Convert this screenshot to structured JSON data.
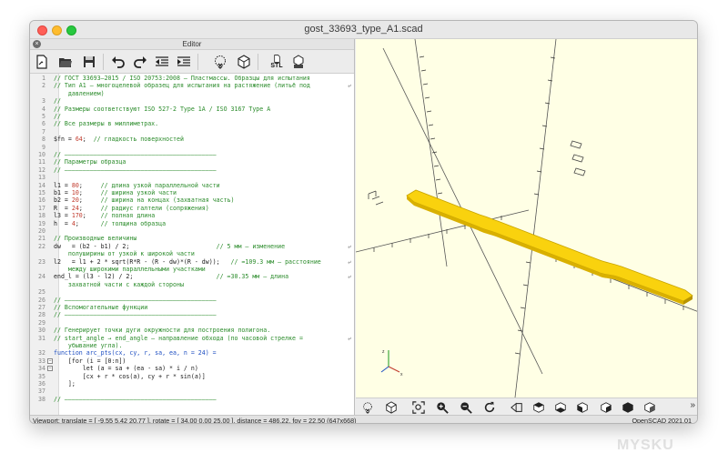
{
  "window": {
    "title": "gost_33693_type_A1.scad"
  },
  "editor": {
    "title": "Editor",
    "close_icon": "close-x",
    "toolbar": [
      "new-file-icon",
      "open-folder-icon",
      "save-icon",
      "undo-icon",
      "redo-icon",
      "unindent-icon",
      "indent-icon",
      "preview-icon",
      "render-icon",
      "export-stl-icon",
      "send-to-print-icon"
    ],
    "stl_label": "STL",
    "lines": [
      {
        "n": "1",
        "t": "// ГОСТ 33693—2015 / ISO 20753:2008 — Пластмассы. Образцы для испытания",
        "c": "comment"
      },
      {
        "n": "2",
        "t": "// Тип А1 — многоцелевой образец для испытания на растяжение (литьё под",
        "c": "comment",
        "wrap": true
      },
      {
        "n": "",
        "t": "    давлением)",
        "c": "comment"
      },
      {
        "n": "3",
        "t": "//",
        "c": "comment"
      },
      {
        "n": "4",
        "t": "// Размеры соответствуют ISO 527-2 Type 1A / ISO 3167 Type A",
        "c": "comment"
      },
      {
        "n": "5",
        "t": "//",
        "c": "comment"
      },
      {
        "n": "6",
        "t": "// Все размеры в миллиметрах.",
        "c": "comment"
      },
      {
        "n": "7",
        "t": "",
        "c": "code"
      },
      {
        "n": "8",
        "t": "$fn = 64;  // гладкость поверхностей",
        "c": "mixed",
        "code": "$fn = ",
        "num": "64",
        "rest": ";  ",
        "cm": "// гладкость поверхностей"
      },
      {
        "n": "9",
        "t": "",
        "c": "code"
      },
      {
        "n": "10",
        "t": "// ——————————————————————————————————————————",
        "c": "comment"
      },
      {
        "n": "11",
        "t": "// Параметры образца",
        "c": "comment"
      },
      {
        "n": "12",
        "t": "// ——————————————————————————————————————————",
        "c": "comment"
      },
      {
        "n": "13",
        "t": "",
        "c": "code"
      },
      {
        "n": "14",
        "t": "l1 = 80;     // длина узкой параллельной части",
        "c": "mixed",
        "code": "l1 = ",
        "num": "80",
        "rest": ";     ",
        "cm": "// длина узкой параллельной части"
      },
      {
        "n": "15",
        "t": "b1 = 10;     // ширина узкой части",
        "c": "mixed",
        "code": "b1 = ",
        "num": "10",
        "rest": ";     ",
        "cm": "// ширина узкой части"
      },
      {
        "n": "16",
        "t": "b2 = 20;     // ширина на концах (захватная часть)",
        "c": "mixed",
        "code": "b2 = ",
        "num": "20",
        "rest": ";     ",
        "cm": "// ширина на концах (захватная часть)"
      },
      {
        "n": "17",
        "t": "R  = 24;     // радиус галтели (сопряжения)",
        "c": "mixed",
        "code": "R  = ",
        "num": "24",
        "rest": ";     ",
        "cm": "// радиус галтели (сопряжения)"
      },
      {
        "n": "18",
        "t": "l3 = 170;    // полная длина",
        "c": "mixed",
        "code": "l3 = ",
        "num": "170",
        "rest": ";    ",
        "cm": "// полная длина"
      },
      {
        "n": "19",
        "t": "h  = 4;      // толщина образца",
        "c": "mixed",
        "code": "h  = ",
        "num": "4",
        "rest": ";      ",
        "cm": "// толщина образца"
      },
      {
        "n": "20",
        "t": "",
        "c": "code"
      },
      {
        "n": "21",
        "t": "// Производные величины",
        "c": "comment"
      },
      {
        "n": "22",
        "t": "dw   = (b2 - b1) / 2;                        // 5 мм — изменение",
        "c": "split",
        "code": "dw   = (b2 - b1) / 2;                        ",
        "cm": "// 5 мм — изменение",
        "wrap": true
      },
      {
        "n": "",
        "t": "    полуширины от узкой к широкой части",
        "c": "comment"
      },
      {
        "n": "23",
        "t": "l2   = l1 + 2 * sqrt(R*R - (R - dw)*(R - dw));   // ≈109.3 мм — расстояние",
        "c": "split",
        "code": "l2   = l1 + 2 * sqrt(R*R - (R - dw)*(R - dw));   ",
        "cm": "// ≈109.3 мм — расстояние",
        "wrap": true
      },
      {
        "n": "",
        "t": "    между широкими параллельными участками",
        "c": "comment"
      },
      {
        "n": "24",
        "t": "end_l = (l3 - l2) / 2;                       // ≈30.35 мм — длина",
        "c": "split",
        "code": "end_l = (l3 - l2) / 2;                       ",
        "cm": "// ≈30.35 мм — длина",
        "wrap": true
      },
      {
        "n": "",
        "t": "    захватной части с каждой стороны",
        "c": "comment"
      },
      {
        "n": "25",
        "t": "",
        "c": "code"
      },
      {
        "n": "26",
        "t": "// ——————————————————————————————————————————",
        "c": "comment"
      },
      {
        "n": "27",
        "t": "// Вспомогательные функции",
        "c": "comment"
      },
      {
        "n": "28",
        "t": "// ——————————————————————————————————————————",
        "c": "comment"
      },
      {
        "n": "29",
        "t": "",
        "c": "code"
      },
      {
        "n": "30",
        "t": "// Генерирует точки дуги окружности для построения полигона.",
        "c": "comment"
      },
      {
        "n": "31",
        "t": "// start_angle → end_angle — направление обхода (по часовой стрелке =",
        "c": "comment",
        "wrap": true
      },
      {
        "n": "",
        "t": "    убывание угла).",
        "c": "comment"
      },
      {
        "n": "32",
        "t": "function arc_pts(cx, cy, r, sa, ea, n = 24) =",
        "c": "code"
      },
      {
        "n": "33",
        "t": "    [for (i = [0:n])",
        "c": "code",
        "fold": true
      },
      {
        "n": "34",
        "t": "        let (a = sa + (ea - sa) * i / n)",
        "c": "code",
        "fold": true
      },
      {
        "n": "35",
        "t": "        [cx + r * cos(a), cy + r * sin(a)]",
        "c": "code"
      },
      {
        "n": "36",
        "t": "    ];",
        "c": "code"
      },
      {
        "n": "37",
        "t": "",
        "c": "code"
      },
      {
        "n": "38",
        "t": "// ——————————————————————————————————————————",
        "c": "comment"
      }
    ]
  },
  "viewer": {
    "background": "#ffffe5",
    "model_color": "#f9d20e",
    "toolbar": [
      "view-all-icon",
      "zoom-fit-icon",
      "zoom-in-icon",
      "zoom-out-icon",
      "reset-view-icon",
      "perspective-icon",
      "top-view-icon",
      "bottom-view-icon",
      "left-view-icon",
      "right-view-icon",
      "front-view-icon",
      "back-view-icon"
    ],
    "more": "»"
  },
  "status": {
    "viewport": "Viewport: translate = [ -9.55 5.42 20.77 ], rotate = [ 34.00 0.00 25.00 ], distance = 486.22, fov = 22.50 (647x668)",
    "version": "OpenSCAD 2021.01"
  },
  "watermark": "MYSKU"
}
